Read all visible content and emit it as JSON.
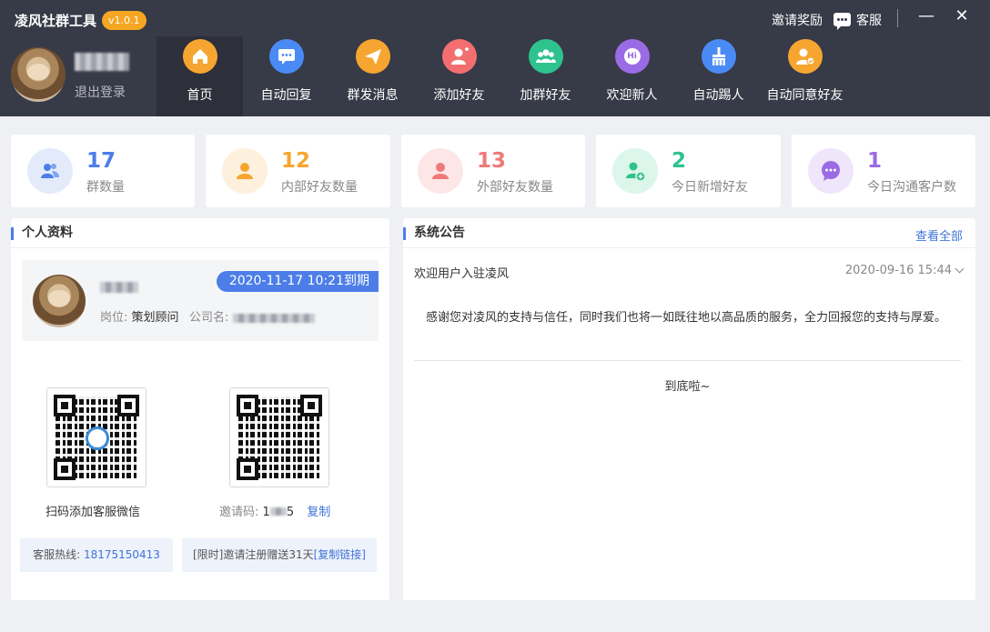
{
  "header": {
    "app_title": "凌风社群工具",
    "version": "v1.0.1",
    "invite_reward": "邀请奖励",
    "customer_service": "客服",
    "minimize": "—",
    "close": "✕",
    "logout": "退出登录"
  },
  "nav": [
    {
      "label": "首页",
      "icon": "home-icon",
      "color": "#f6a630"
    },
    {
      "label": "自动回复",
      "icon": "chat-icon",
      "color": "#4a8af4"
    },
    {
      "label": "群发消息",
      "icon": "send-icon",
      "color": "#f6a630"
    },
    {
      "label": "添加好友",
      "icon": "add-user-icon",
      "color": "#f36f6f"
    },
    {
      "label": "加群好友",
      "icon": "group-icon",
      "color": "#2ec28e"
    },
    {
      "label": "欢迎新人",
      "icon": "hi-icon",
      "glyph": "Hi",
      "color": "#9b6be6"
    },
    {
      "label": "自动踢人",
      "icon": "broom-icon",
      "color": "#4a8af4"
    },
    {
      "label": "自动同意好友",
      "icon": "approve-user-icon",
      "color": "#f6a630"
    }
  ],
  "stats": [
    {
      "value": "17",
      "label": "群数量",
      "color": "#4d7ee8",
      "bg": "#e6edfb"
    },
    {
      "value": "12",
      "label": "内部好友数量",
      "color": "#f6a630",
      "bg": "#fdf0dc"
    },
    {
      "value": "13",
      "label": "外部好友数量",
      "color": "#ef7a7a",
      "bg": "#fde6e6"
    },
    {
      "value": "2",
      "label": "今日新增好友",
      "color": "#2ec28e",
      "bg": "#dcf6ec"
    },
    {
      "value": "1",
      "label": "今日沟通客户数",
      "color": "#9b6be6",
      "bg": "#efe6fb"
    }
  ],
  "profile": {
    "title": "个人资料",
    "expire": "2020-11-17 10:21到期",
    "position_label": "岗位:",
    "position_value": "策划顾问",
    "company_label": "公司名:",
    "qr_caption": "扫码添加客服微信",
    "invite_label": "邀请码:",
    "invite_visible": "1",
    "invite_tail": "5",
    "copy": "复制",
    "hotline_label": "客服热线:",
    "hotline": "18175150413",
    "promo": "[限时]邀请注册赠送31天",
    "copy_link": "[复制链接]"
  },
  "notice": {
    "title": "系统公告",
    "view_all": "查看全部",
    "item_title": "欢迎用户入驻凌风",
    "item_date": "2020-09-16 15:44",
    "item_body": "感谢您对凌风的支持与信任，同时我们也将一如既往地以高品质的服务，全力回报您的支持与厚爱。",
    "end": "到底啦~"
  }
}
